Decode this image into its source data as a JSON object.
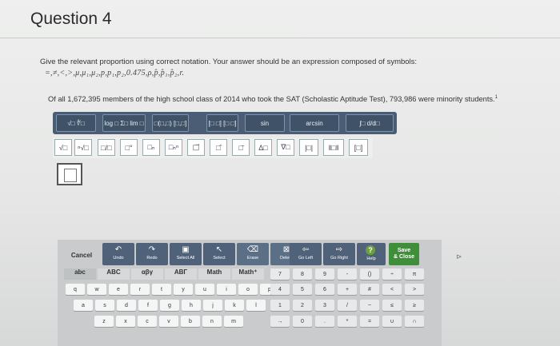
{
  "page": {
    "title": "Question 4",
    "prompt": "Give the relevant proportion using correct notation. Your answer should be an expression composed of symbols:",
    "symbols": "=,≠,<,>,μ,μ₁,μ₂,p,p₁,p₂,0.475,ρ,p̂,p̂₁,p̂₂,r.",
    "context": "Of all 1,672,395 members of the high school class of 2014 who took the SAT (Scholastic Aptitude Test), 793,986 were minority students.",
    "footnote": "1"
  },
  "toolbar1": {
    "buttons": [
      "√□ ∜□",
      "log □ Σ□ lim □",
      "□(□,□) [□,□]",
      "[□ □] [□ □]",
      "sin",
      "arcsin",
      "∫□ d/d□"
    ]
  },
  "toolbar2": {
    "buttons": [
      "√□",
      "ⁿ√□",
      "□/□",
      "□°",
      "□ₙ",
      "□ₙⁿ",
      "□⃗",
      "□̂",
      "□̄",
      "Δ□",
      "∇□",
      "|□|",
      "‖□‖",
      "[□]"
    ]
  },
  "commands": {
    "cancel": "Cancel",
    "undo": "Undo",
    "redo": "Redo",
    "select_all": "Select All",
    "select": "Select",
    "erase": "Erase",
    "delete": "Delete",
    "go_left": "Go Left",
    "go_right": "Go Right",
    "help": "Help",
    "save_line1": "Save",
    "save_line2": "& Close"
  },
  "modes": [
    "abc",
    "ABC",
    "αβγ",
    "ΑΒΓ",
    "Math",
    "Math⁺"
  ],
  "keys": {
    "row1": [
      "q",
      "w",
      "e",
      "r",
      "t",
      "y",
      "u",
      "i",
      "o",
      "p"
    ],
    "row2": [
      "a",
      "s",
      "d",
      "f",
      "g",
      "h",
      "j",
      "k",
      "l"
    ],
    "row3": [
      "z",
      "x",
      "c",
      "v",
      "b",
      "n",
      "m"
    ],
    "num1": [
      "7",
      "8",
      "9",
      "-",
      "()",
      "÷",
      "π"
    ],
    "num2": [
      "4",
      "5",
      "6",
      "+",
      "#",
      "<",
      ">"
    ],
    "num3": [
      "1",
      "2",
      "3",
      "/",
      "~",
      "≤",
      "≥"
    ],
    "num4": [
      "→",
      "0",
      ".",
      "*",
      "=",
      "∪",
      "∩"
    ]
  },
  "icons": [
    "undo-icon",
    "redo-icon",
    "select-all-icon",
    "select-icon",
    "erase-icon",
    "delete-icon",
    "go-left-icon",
    "go-right-icon",
    "help-icon"
  ]
}
